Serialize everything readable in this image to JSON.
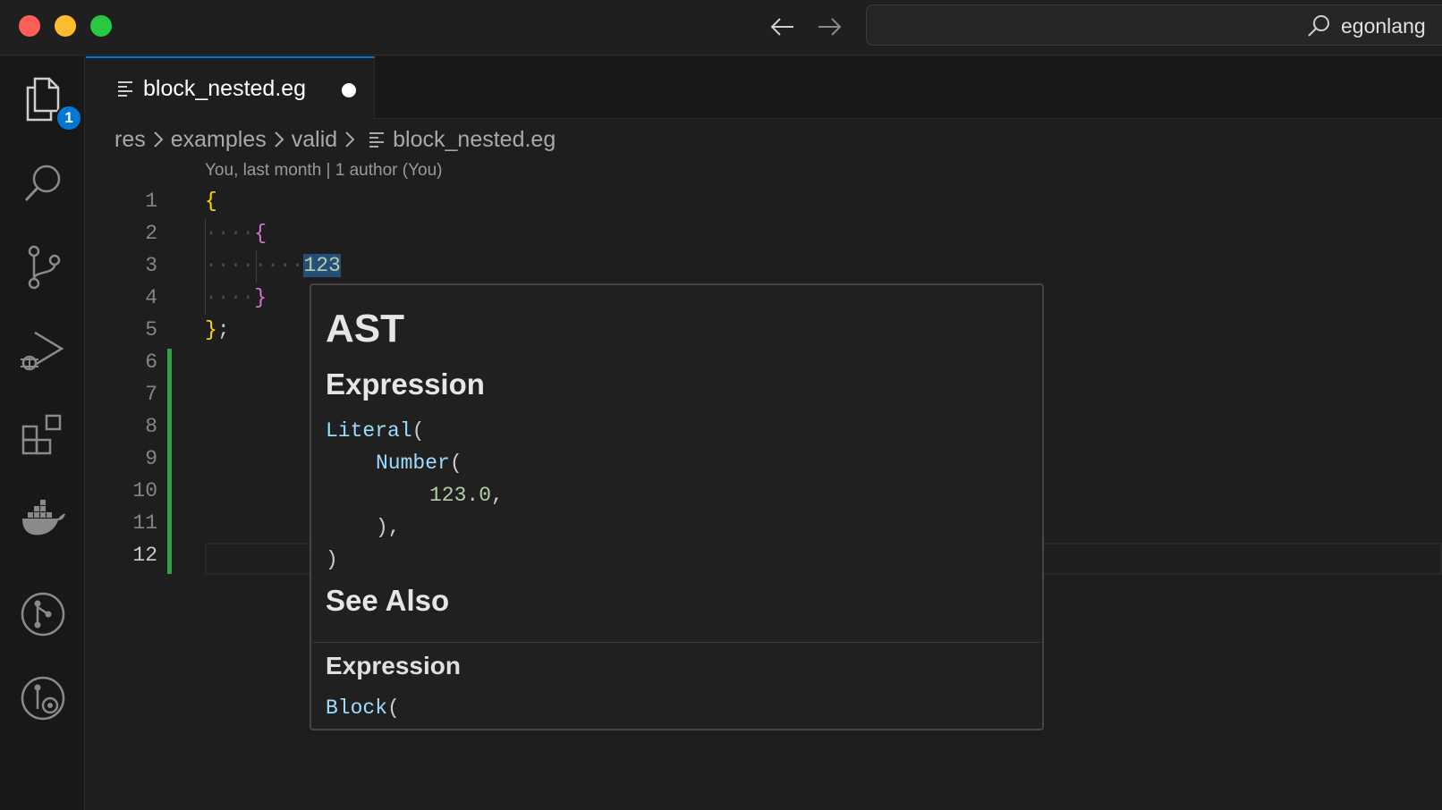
{
  "titlebar": {
    "search_text": "egonlang"
  },
  "activity": {
    "explorer_badge": "1"
  },
  "tab": {
    "label": "block_nested.eg"
  },
  "breadcrumb": {
    "items": [
      "res",
      "examples",
      "valid",
      "block_nested.eg"
    ]
  },
  "blame": {
    "text": "You, last month | 1 author (You)"
  },
  "editor": {
    "line_numbers": [
      "1",
      "2",
      "3",
      "4",
      "5",
      "6",
      "7",
      "8",
      "9",
      "10",
      "11",
      "12"
    ],
    "active_line": "12",
    "code": {
      "l1_brace": "{",
      "l2_ws": "····",
      "l2_brace": "{",
      "l3_ws": "····",
      "l3_ws2": "····",
      "l3_num": "123",
      "l4_ws": "····",
      "l4_brace": "}",
      "l5_brace": "}",
      "l5_semi": ";"
    }
  },
  "hover": {
    "title": "AST",
    "section1": "Expression",
    "code": {
      "l1_type": "Literal",
      "l1_paren": "(",
      "l2_type": "Number",
      "l2_paren": "(",
      "l3_num": "123.0",
      "l3_comma": ",",
      "l4": "),",
      "l5": ")"
    },
    "section2": "See Also",
    "section3": "Expression",
    "code2": {
      "type": "Block",
      "paren": "("
    }
  },
  "colors": {
    "accent": "#0078d4",
    "added": "#2ea043"
  }
}
